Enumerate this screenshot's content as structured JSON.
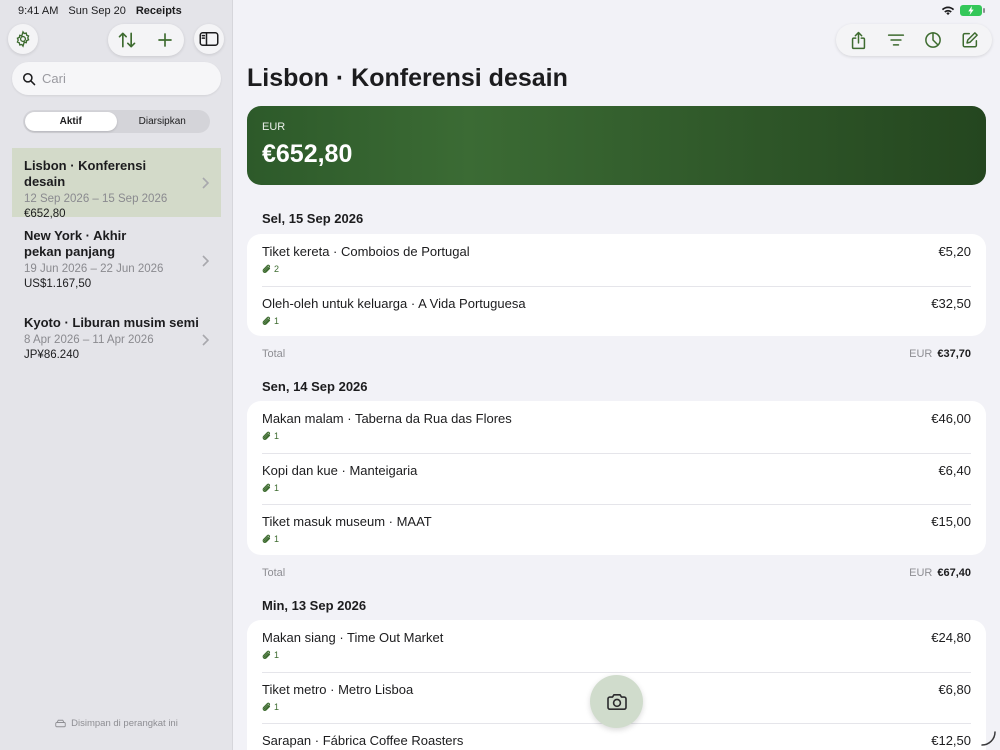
{
  "status": {
    "time": "9:41 AM",
    "date": "Sun Sep 20",
    "app_name": "Receipts"
  },
  "sidebar": {
    "search_placeholder": "Cari",
    "segments": [
      {
        "label": "Aktif",
        "active": true
      },
      {
        "label": "Diarsipkan",
        "active": false
      }
    ],
    "trips": [
      {
        "title": "Lisbon · Konferensi desain",
        "dates": "12 Sep 2026 – 15 Sep 2026",
        "amount": "€652,80",
        "selected": true
      },
      {
        "title": "New York · Akhir pekan panjang",
        "dates": "19 Jun 2026 – 22 Jun 2026",
        "amount": "US$1.167,50",
        "selected": false
      },
      {
        "title": "Kyoto · Liburan musim semi",
        "dates": "8 Apr 2026 – 11 Apr 2026",
        "amount": "JP¥86.240",
        "selected": false
      }
    ],
    "footer_note": "Disimpan di perangkat ini"
  },
  "main": {
    "title": "Lisbon · Konferensi desain",
    "hero": {
      "currency": "EUR",
      "amount": "€652,80",
      "accent": "#2d5a2a"
    },
    "days": [
      {
        "header": "Sel, 15 Sep 2026",
        "items": [
          {
            "title": "Tiket kereta · Comboios de Portugal",
            "amount": "€5,20",
            "attachments": "2"
          },
          {
            "title": "Oleh-oleh untuk keluarga · A Vida Portuguesa",
            "amount": "€32,50",
            "attachments": "1"
          }
        ],
        "total_label": "Total",
        "total_currency": "EUR",
        "total_amount": "€37,70"
      },
      {
        "header": "Sen, 14 Sep 2026",
        "items": [
          {
            "title": "Makan malam · Taberna da Rua das Flores",
            "amount": "€46,00",
            "attachments": "1"
          },
          {
            "title": "Kopi dan kue · Manteigaria",
            "amount": "€6,40",
            "attachments": "1"
          },
          {
            "title": "Tiket masuk museum · MAAT",
            "amount": "€15,00",
            "attachments": "1"
          }
        ],
        "total_label": "Total",
        "total_currency": "EUR",
        "total_amount": "€67,40"
      },
      {
        "header": "Min, 13 Sep 2026",
        "items": [
          {
            "title": "Makan siang · Time Out Market",
            "amount": "€24,80",
            "attachments": "1"
          },
          {
            "title": "Tiket metro · Metro Lisboa",
            "amount": "€6,80",
            "attachments": "1"
          },
          {
            "title": "Sarapan · Fábrica Coffee Roasters",
            "amount": "€12,50",
            "attachments": ""
          }
        ]
      }
    ]
  },
  "icons": {
    "settings": "gear-icon",
    "sort": "sort-arrows-icon",
    "add": "plus-icon",
    "sidebar": "sidebar-toggle-icon",
    "share": "share-icon",
    "filter": "filter-lines-icon",
    "chart": "pie-chart-icon",
    "edit": "compose-icon",
    "camera": "camera-icon",
    "attachment": "paperclip-icon",
    "accent_green": "#3d6b2f"
  }
}
